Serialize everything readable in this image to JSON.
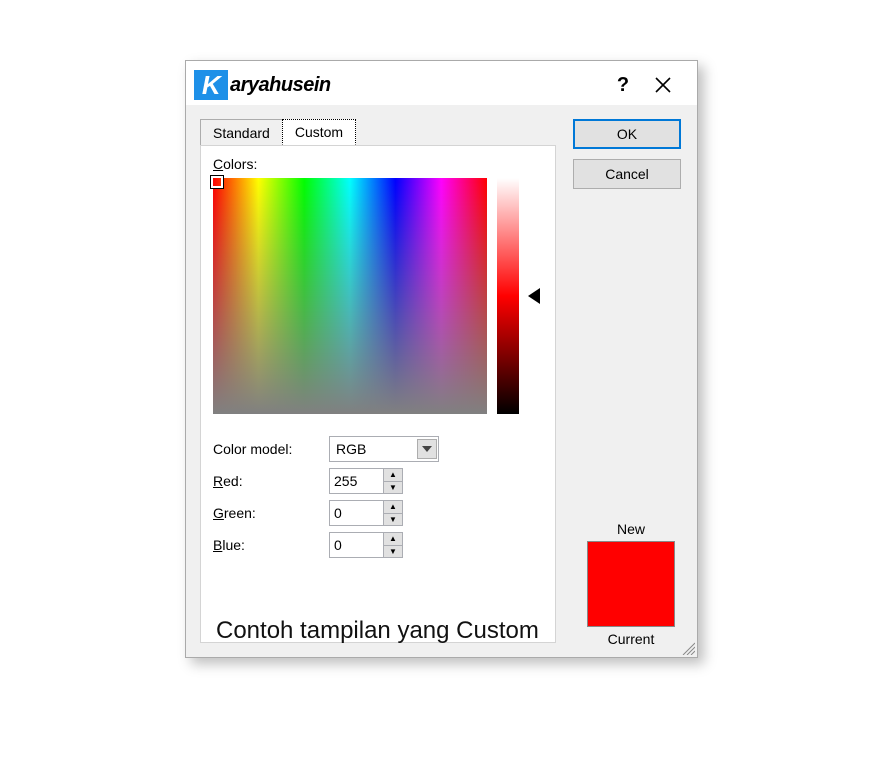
{
  "title": "aryahusein",
  "logoLetter": "K",
  "helpGlyph": "?",
  "tabs": {
    "standard": "Standard",
    "custom": "Custom"
  },
  "buttons": {
    "ok": "OK",
    "cancel": "Cancel"
  },
  "colorsLabel": "olors:",
  "colorsUnderline": "C",
  "colorModelLabel": "Color model:",
  "colorModelValue": "RGB",
  "fields": {
    "red": {
      "underline": "R",
      "rest": "ed:",
      "value": "255"
    },
    "green": {
      "underline": "G",
      "rest": "reen:",
      "value": "0"
    },
    "blue": {
      "underline": "B",
      "rest": "lue:",
      "value": "0"
    }
  },
  "preview": {
    "newLabel": "New",
    "currentLabel": "Current"
  },
  "caption": "Contoh tampilan yang Custom"
}
